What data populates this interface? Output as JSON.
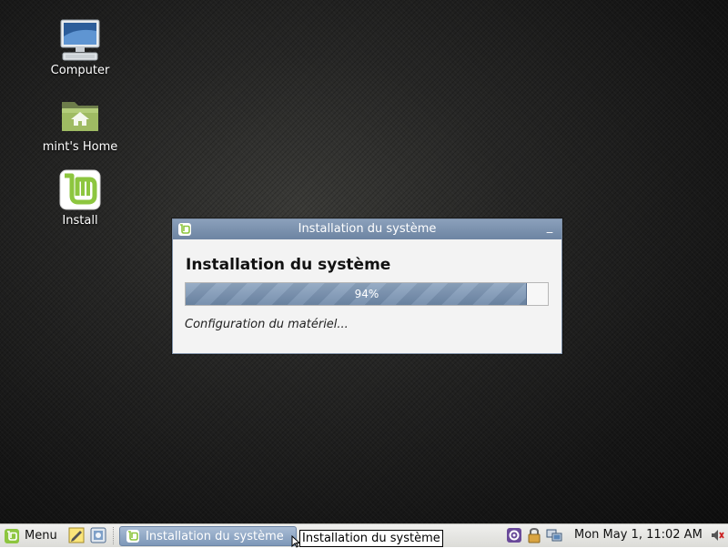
{
  "desktop": {
    "icons": [
      {
        "label": "Computer",
        "icon": "computer-icon"
      },
      {
        "label": "mint's Home",
        "icon": "home-folder-icon"
      },
      {
        "label": "Install",
        "icon": "mint-install-icon"
      }
    ]
  },
  "dialog": {
    "title": "Installation du système",
    "heading": "Installation du système",
    "progress_percent": 94,
    "progress_label": "94%",
    "status": "Configuration du matériel...",
    "minimize_label": "_"
  },
  "taskbar": {
    "menu_label": "Menu",
    "task_label": "Installation du système",
    "tooltip": "Installation du système",
    "clock": "Mon May  1, 11:02 AM",
    "launchers": [
      "text-editor-icon",
      "screenshot-icon"
    ],
    "tray": [
      "settings-gear-icon",
      "update-lock-icon",
      "network-icon",
      "volume-icon"
    ]
  },
  "colors": {
    "titlebar": "#7a90ae",
    "progress_fill": "#7e97b6",
    "mint_green": "#8dc63f"
  }
}
